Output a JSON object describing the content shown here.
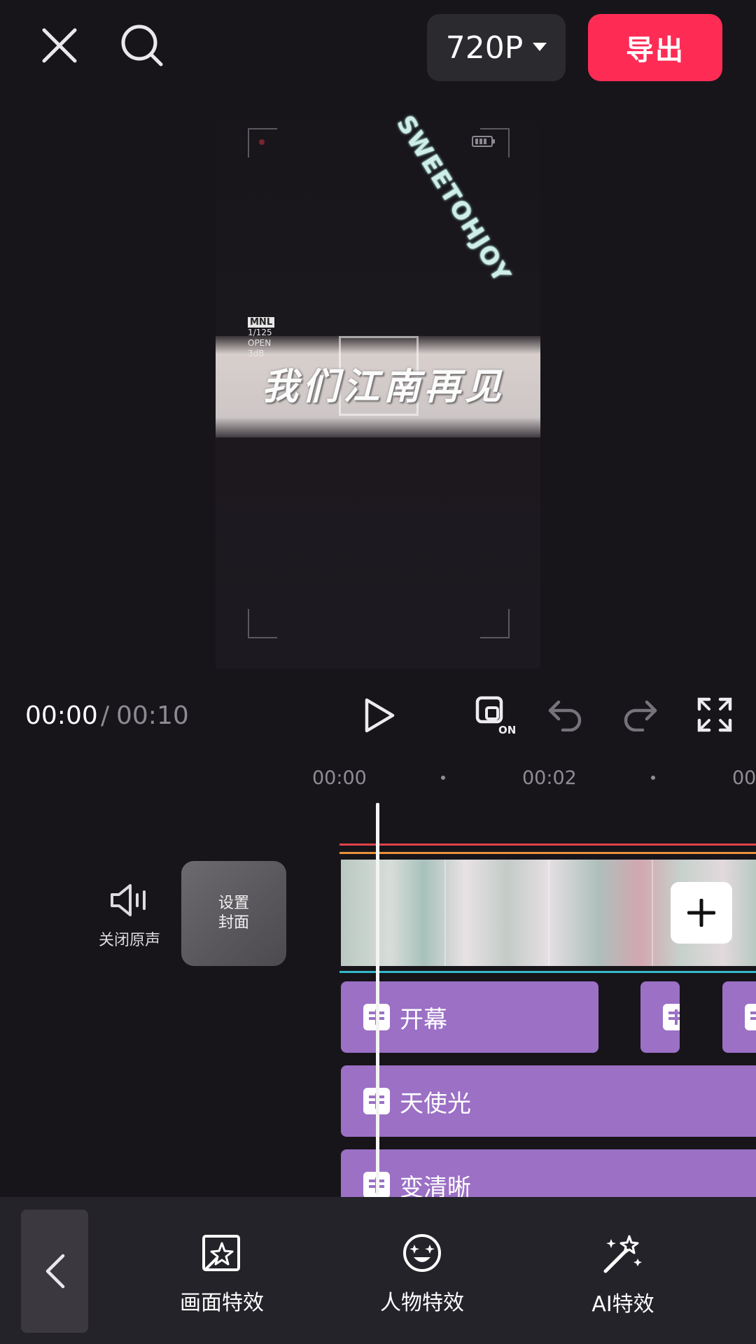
{
  "topbar": {
    "resolution": "720P",
    "export_label": "导出"
  },
  "preview": {
    "title_text": "我们江南再见",
    "sticker_text": "SWEETOHJOY",
    "camera_badge": "MNL",
    "camera_lines": [
      "1/125",
      "OPEN",
      "3dB"
    ]
  },
  "playback": {
    "current_time": "00:00",
    "separator": "/",
    "total_time": "00:10"
  },
  "timeline": {
    "ticks": [
      "00:00",
      "00:02",
      "00"
    ],
    "mute_label": "关闭原声",
    "cover_label_line1": "设置",
    "cover_label_line2": "封面",
    "effects": [
      {
        "label": "开幕"
      },
      {
        "label": ""
      },
      {
        "label": ""
      },
      {
        "label": "天使光"
      },
      {
        "label": "变清晰"
      }
    ]
  },
  "toolbar": {
    "items": [
      {
        "label": "画面特效",
        "icon": "frame-effect-icon"
      },
      {
        "label": "人物特效",
        "icon": "face-effect-icon"
      },
      {
        "label": "AI特效",
        "icon": "magic-wand-icon"
      }
    ]
  },
  "colors": {
    "background": "#17151a",
    "export": "#fe2c55",
    "effect_clip": "#9b70c5",
    "track_red": "#e0424a",
    "track_orange": "#e8913c",
    "track_cyan": "#33b9c9"
  }
}
